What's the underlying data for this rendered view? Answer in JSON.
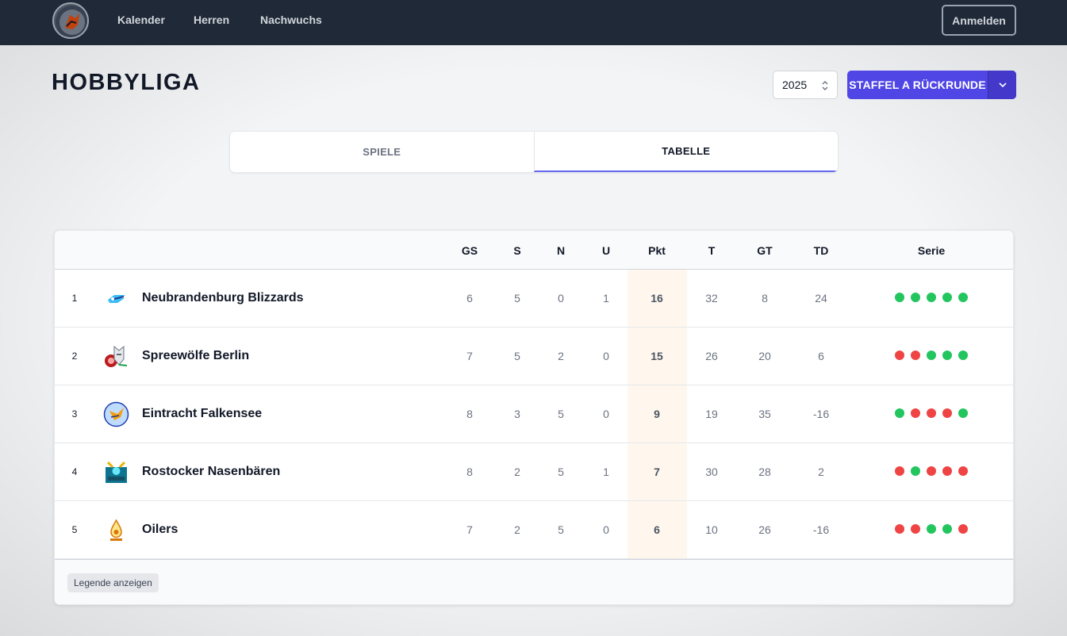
{
  "nav": {
    "links": [
      "Kalender",
      "Herren",
      "Nachwuchs"
    ],
    "login_label": "Anmelden"
  },
  "header": {
    "title": "HOBBYLIGA",
    "year": "2025",
    "staffel_label": "STAFFEL A RÜCKRUNDE"
  },
  "tabs": [
    {
      "label": "SPIELE",
      "active": false
    },
    {
      "label": "TABELLE",
      "active": true
    }
  ],
  "table": {
    "columns": [
      "GS",
      "S",
      "N",
      "U",
      "Pkt",
      "T",
      "GT",
      "TD",
      "Serie"
    ],
    "rows": [
      {
        "rank": "1",
        "team": "Neubrandenburg Blizzards",
        "logo": "blizzards-logo-icon",
        "gs": "6",
        "s": "5",
        "n": "0",
        "u": "1",
        "pkt": "16",
        "t": "32",
        "gt": "8",
        "td": "24",
        "serie": [
          "W",
          "W",
          "W",
          "W",
          "W"
        ]
      },
      {
        "rank": "2",
        "team": "Spreewölfe Berlin",
        "logo": "spreewoelfe-logo-icon",
        "gs": "7",
        "s": "5",
        "n": "2",
        "u": "0",
        "pkt": "15",
        "t": "26",
        "gt": "20",
        "td": "6",
        "serie": [
          "L",
          "L",
          "W",
          "W",
          "W"
        ]
      },
      {
        "rank": "3",
        "team": "Eintracht Falkensee",
        "logo": "falkensee-logo-icon",
        "gs": "8",
        "s": "3",
        "n": "5",
        "u": "0",
        "pkt": "9",
        "t": "19",
        "gt": "35",
        "td": "-16",
        "serie": [
          "W",
          "L",
          "L",
          "L",
          "W"
        ]
      },
      {
        "rank": "4",
        "team": "Rostocker Nasenbären",
        "logo": "nasenbaeren-logo-icon",
        "gs": "8",
        "s": "2",
        "n": "5",
        "u": "1",
        "pkt": "7",
        "t": "30",
        "gt": "28",
        "td": "2",
        "serie": [
          "L",
          "W",
          "L",
          "L",
          "L"
        ]
      },
      {
        "rank": "5",
        "team": "Oilers",
        "logo": "oilers-logo-icon",
        "gs": "7",
        "s": "2",
        "n": "5",
        "u": "0",
        "pkt": "6",
        "t": "10",
        "gt": "26",
        "td": "-16",
        "serie": [
          "L",
          "L",
          "W",
          "W",
          "L"
        ]
      }
    ]
  },
  "footer": {
    "legend_label": "Legende anzeigen"
  },
  "colors": {
    "navbar": "#1f2937",
    "accent": "#4f46e5",
    "win": "#22c55e",
    "loss": "#ef4444",
    "points_highlight": "#fff7ed"
  }
}
